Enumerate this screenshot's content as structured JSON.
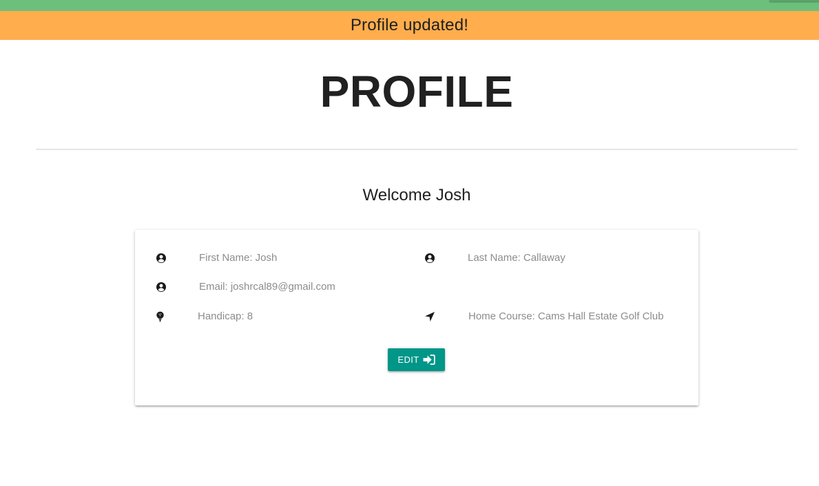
{
  "flash": {
    "message": "Profile updated!"
  },
  "page": {
    "title": "PROFILE",
    "welcome": "Welcome Josh"
  },
  "profile": {
    "first_name": "First Name: Josh",
    "last_name": "Last Name: Callaway",
    "email": "Email: joshrcal89@gmail.com",
    "handicap": "Handicap: 8",
    "home_course": "Home Course: Cams Hall Estate Golf Club"
  },
  "actions": {
    "edit_label": "EDIT"
  },
  "icons": {
    "first_name": "account-circle-icon",
    "last_name": "account-circle-icon",
    "email": "account-circle-icon",
    "handicap": "golf-ball-tee-icon",
    "home_course": "location-arrow-icon",
    "edit": "sign-in-icon"
  },
  "colors": {
    "top_bar": "#6cc07b",
    "flash_background": "#ffad4d",
    "edit_button": "#009688",
    "field_text": "#8c8c8c"
  }
}
